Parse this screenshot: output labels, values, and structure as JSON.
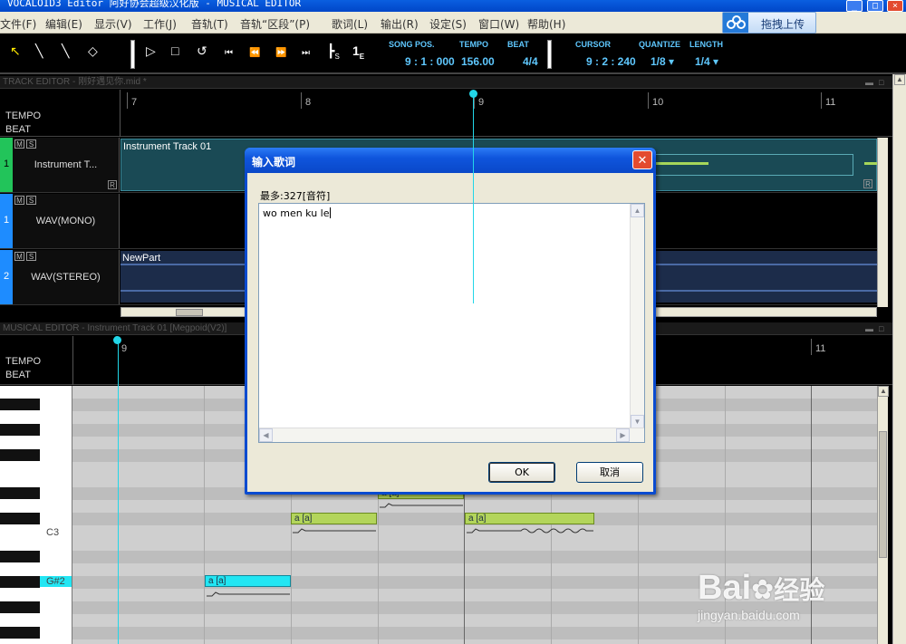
{
  "window": {
    "title": "VOCALOID3 Editor 阿好协会超级汉化版 - MUSICAL EDITOR",
    "controls": [
      "_",
      "□",
      "×"
    ]
  },
  "menu": {
    "items": [
      "文件(F)",
      "编辑(E)",
      "显示(V)",
      "工作(J)",
      "音轨(T)",
      "音轨“区段”(P)",
      "歌词(L)",
      "输出(R)",
      "设定(S)",
      "窗口(W)",
      "帮助(H)"
    ],
    "upload_button": "拖拽上传"
  },
  "toolbar": {
    "tools": [
      "↖",
      "╲",
      "╲",
      "◇",
      "▷",
      "□",
      "↺",
      "⏮",
      "⏪",
      "⏩",
      "⏭",
      "┣",
      "1"
    ],
    "tool_sub": [
      "S",
      "E"
    ],
    "song_pos_label": "SONG POS.",
    "song_pos_value": "9 : 1 : 000",
    "tempo_label": "TEMPO",
    "tempo_value": "156.00",
    "beat_label": "BEAT",
    "beat_value": "4/4",
    "cursor_label": "CURSOR",
    "cursor_value": "9 : 2 : 240",
    "quantize_label": "QUANTIZE",
    "quantize_value": "1/8 ▾",
    "length_label": "LENGTH",
    "length_value": "1/4 ▾"
  },
  "track_editor": {
    "title": "TRACK EDITOR - 刚好遇见你.mid *",
    "ruler_numbers": [
      "7",
      "8",
      "9",
      "10",
      "11"
    ],
    "tempo_label": "TEMPO",
    "beat_label": "BEAT",
    "tracks": [
      {
        "num": "1",
        "name": "Instrument T...",
        "part": "Instrument Track 01",
        "color": "#22c45a"
      },
      {
        "num": "1",
        "name": "WAV(MONO)",
        "part": "",
        "color": "#1e8cff"
      },
      {
        "num": "2",
        "name": "WAV(STEREO)",
        "part": "NewPart",
        "color": "#1e8cff"
      }
    ],
    "m_label": "M",
    "s_label": "S",
    "r_label": "R"
  },
  "musical_editor": {
    "title": "MUSICAL EDITOR - Instrument Track 01 [Megpoid(V2)]",
    "ruler_numbers": [
      "9",
      "11"
    ],
    "tempo_label": "TEMPO",
    "beat_label": "BEAT",
    "key_c3": "C3",
    "key_g2": "G#2",
    "notes": [
      {
        "lyric": "a [a]",
        "color": "cyan"
      },
      {
        "lyric": "a [a]",
        "color": "green"
      },
      {
        "lyric": "a [a]",
        "color": "green"
      },
      {
        "lyric": "a [a]",
        "color": "green"
      }
    ]
  },
  "dialog": {
    "title": "输入歌词",
    "max_label": "最多:327[音符]",
    "lyrics_text": "wo men ku le",
    "ok_label": "OK",
    "cancel_label": "取消",
    "close_label": "✕"
  },
  "watermark": {
    "brand": "Bai",
    "brand_suffix": "经验",
    "url": "jingyan.baidu.com"
  }
}
